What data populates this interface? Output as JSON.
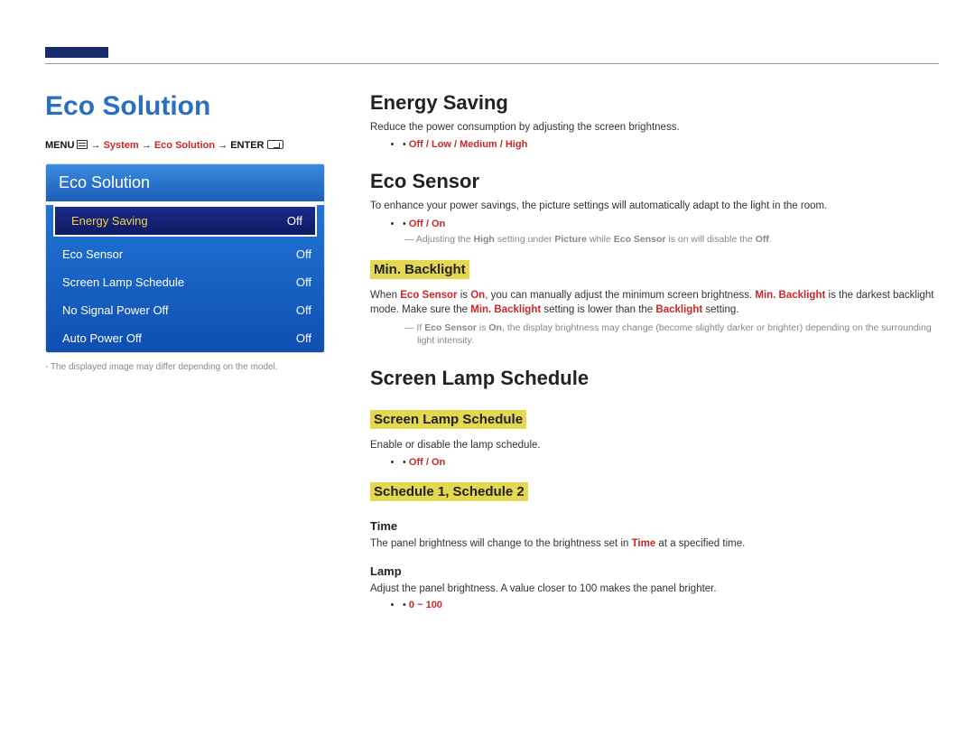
{
  "accent": "#1a2b6d",
  "left": {
    "title": "Eco Solution",
    "path_menu": "MENU",
    "path_system": "System",
    "path_eco": "Eco Solution",
    "path_enter": "ENTER",
    "arrow": "→",
    "menu_header": "Eco Solution",
    "items": [
      {
        "label": "Energy Saving",
        "value": "Off"
      },
      {
        "label": "Eco Sensor",
        "value": "Off"
      },
      {
        "label": "Screen Lamp Schedule",
        "value": "Off"
      },
      {
        "label": "No Signal Power Off",
        "value": "Off"
      },
      {
        "label": "Auto Power Off",
        "value": "Off"
      }
    ],
    "disclaimer": "The displayed image may differ depending on the model."
  },
  "right": {
    "energy_saving": {
      "title": "Energy Saving",
      "desc": "Reduce the power consumption by adjusting the screen brightness.",
      "options": "Off / Low / Medium / High"
    },
    "eco_sensor": {
      "title": "Eco Sensor",
      "desc": "To enhance your power savings, the picture settings will automatically adapt to the light in the room.",
      "options": "Off / On",
      "note_a": "Adjusting the ",
      "note_b": "High",
      "note_c": " setting under ",
      "note_d": "Picture",
      "note_e": " while ",
      "note_f": "Eco Sensor",
      "note_g": " is on will disable the ",
      "note_h": "Off",
      "note_i": ".",
      "min_title": "Min. Backlight",
      "min_a": "When ",
      "min_b": "Eco Sensor",
      "min_c": " is ",
      "min_d": "On",
      "min_e": ", you can manually adjust the minimum screen brightness. ",
      "min_f": "Min. Backlight",
      "min_g": " is the darkest backlight mode. Make sure the ",
      "min_h": "Min. Backlight",
      "min_i": " setting is lower than the ",
      "min_j": "Backlight",
      "min_k": " setting.",
      "min_note_a": "If ",
      "min_note_b": "Eco Sensor",
      "min_note_c": " is ",
      "min_note_d": "On",
      "min_note_e": ", the display brightness may change (become slightly darker or brighter) depending on the surrounding light intensity."
    },
    "sls": {
      "title": "Screen Lamp Schedule",
      "sub1": "Screen Lamp Schedule",
      "sub1_desc": "Enable or disable the lamp schedule.",
      "sub1_opts": "Off / On",
      "sub2": "Schedule 1, Schedule 2",
      "time_h": "Time",
      "time_a": "The panel brightness will change to the brightness set in ",
      "time_b": "Time",
      "time_c": " at a specified time.",
      "lamp_h": "Lamp",
      "lamp_desc": "Adjust the panel brightness. A value closer to 100 makes the panel brighter.",
      "lamp_opts": "0 ~ 100"
    }
  }
}
